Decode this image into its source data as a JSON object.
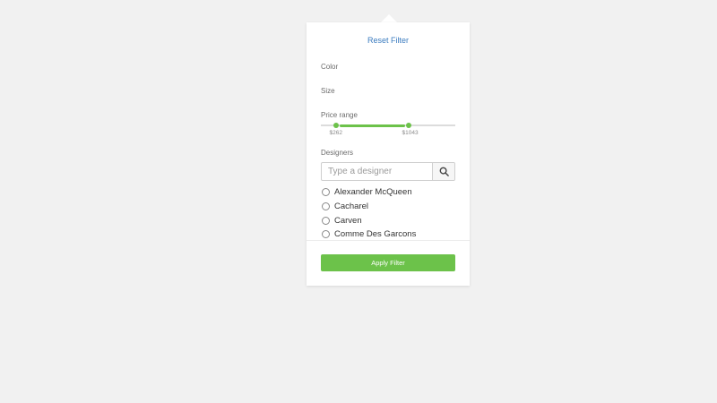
{
  "filter": {
    "reset_label": "Reset Filter",
    "sections": {
      "color": "Color",
      "size": "Size",
      "price": "Price range",
      "designers": "Designers"
    },
    "price_range": {
      "min_label": "$262",
      "max_label": "$1043",
      "low_fraction": 0.11,
      "high_fraction": 0.65
    },
    "search": {
      "placeholder": "Type a designer",
      "value": "",
      "icon": "search-icon"
    },
    "designers": [
      "Alexander McQueen",
      "Cacharel",
      "Carven",
      "Comme Des Garcons"
    ],
    "apply_label": "Apply Filter",
    "colors": {
      "accent": "#6cc24a",
      "link": "#3a7bbf",
      "background": "#f1f1f1"
    }
  }
}
